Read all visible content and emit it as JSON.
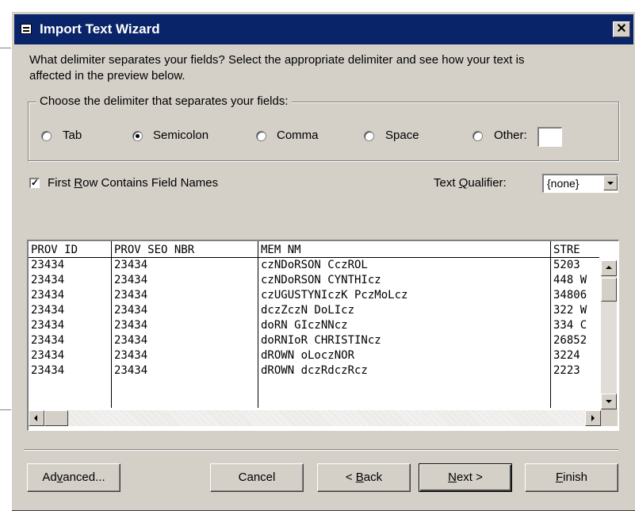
{
  "window": {
    "title": "Import Text Wizard",
    "close_glyph": "✕"
  },
  "instructions": {
    "line1": "What delimiter separates your fields?  Select the appropriate delimiter and see how your text is",
    "line2": "affected in the preview below."
  },
  "delimiter_group": {
    "legend": "Choose the delimiter that separates your fields:",
    "options": [
      {
        "label": "Tab",
        "checked": false
      },
      {
        "label": "Semicolon",
        "checked": true
      },
      {
        "label": "Comma",
        "checked": false
      },
      {
        "label": "Space",
        "checked": false
      },
      {
        "label": "Other:",
        "checked": false
      }
    ],
    "other_value": ""
  },
  "first_row": {
    "label_pre": "First ",
    "label_ul": "R",
    "label_post": "ow Contains Field Names",
    "checked": true
  },
  "qualifier": {
    "label_pre": "Text ",
    "label_ul": "Q",
    "label_post": "ualifier:",
    "value": "{none}"
  },
  "preview": {
    "columns": [
      "PROV ID",
      "PROV SEO NBR",
      "MEM NM",
      "STRE"
    ],
    "rows": [
      [
        "23434",
        "23434",
        "czNDoRSON CczROL",
        "5203"
      ],
      [
        "23434",
        "23434",
        "czNDoRSON CYNTHIcz",
        "448 W"
      ],
      [
        "23434",
        "23434",
        "czUGUSTYNIczK PczMoLcz",
        "34806"
      ],
      [
        "23434",
        "23434",
        "dczZczN DoLIcz",
        "322 W"
      ],
      [
        "23434",
        "23434",
        "doRN GIczNNcz",
        "334 C"
      ],
      [
        "23434",
        "23434",
        "doRNIoR CHRISTINcz",
        "26852"
      ],
      [
        "23434",
        "23434",
        "dROWN oLoczNOR",
        "3224"
      ],
      [
        "23434",
        "23434",
        "dROWN dczRdczRcz",
        "2223"
      ]
    ]
  },
  "buttons": {
    "advanced": {
      "pre": "Ad",
      "ul": "v",
      "post": "anced..."
    },
    "cancel": {
      "pre": "Cancel",
      "ul": "",
      "post": ""
    },
    "back": {
      "pre": "< ",
      "ul": "B",
      "post": "ack"
    },
    "next": {
      "pre": "",
      "ul": "N",
      "post": "ext >"
    },
    "finish": {
      "pre": "",
      "ul": "F",
      "post": "inish"
    }
  }
}
